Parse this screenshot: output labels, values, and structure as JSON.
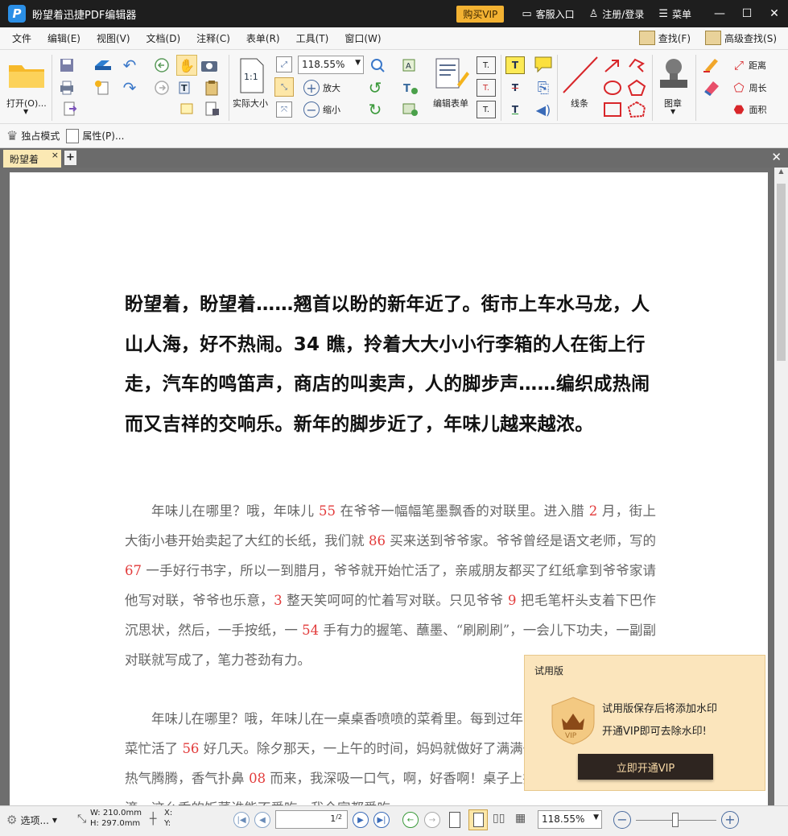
{
  "app": {
    "title": "盼望着迅捷PDF编辑器",
    "logo_letter": "P"
  },
  "titlebar": {
    "buy_vip": "购买VIP",
    "support": "客服入口",
    "login": "注册/登录",
    "menu": "菜单"
  },
  "menubar": {
    "items": [
      "文件",
      "编辑(E)",
      "视图(V)",
      "文档(D)",
      "注释(C)",
      "表单(R)",
      "工具(T)",
      "窗口(W)"
    ],
    "search": "查找(F)",
    "advanced_search": "高级查找(S)"
  },
  "toolbar": {
    "open": "打开(O)...",
    "actual_size": "实际大小",
    "zoom_value": "118.55%",
    "zoom_in": "放大",
    "zoom_out": "缩小",
    "edit_form": "编辑表单",
    "lines": "线条",
    "stamp": "图章",
    "distance": "距离",
    "perimeter": "周长",
    "area": "面积",
    "actual_size_icon": "1:1"
  },
  "modebar": {
    "exclusive": "独占模式",
    "properties": "属性(P)..."
  },
  "tabs": {
    "doc_tab": "盼望着"
  },
  "document": {
    "bold_paragraph": "盼望着，盼望着……翘首以盼的新年近了。街市上车水马龙，人山人海，好不热闹。34 瞧，拎着大大小小行李箱的人在街上行走，汽车的鸣笛声，商店的叫卖声，人的脚步声……编织成热闹而又吉祥的交响乐。新年的脚步近了，年味儿越来越浓。",
    "para1": [
      {
        "t": "年味儿在哪里？哦，年味儿 "
      },
      {
        "n": "55"
      },
      {
        "t": " 在爷爷一幅幅笔墨飘香的对联里。进入腊 "
      },
      {
        "n": "2"
      },
      {
        "t": " 月，街上大街小巷开始卖起了大红的长纸，我们就 "
      },
      {
        "n": "86"
      },
      {
        "t": " 买来送到爷爷家。爷爷曾经是语文老师，写的 "
      },
      {
        "n": "67"
      },
      {
        "t": " 一手好行书字，所以一到腊月，爷爷就开始忙活了，亲戚朋友都买了红纸拿到爷爷家请他写对联，爷爷也乐意，"
      },
      {
        "n": "3"
      },
      {
        "t": " 整天笑呵呵的忙着写对联。只见爷爷 "
      },
      {
        "n": "9"
      },
      {
        "t": " 把毛笔杆头支着下巴作沉思状，然后，一手按纸，一 "
      },
      {
        "n": "54"
      },
      {
        "t": " 手有力的握笔、蘸墨、“刷刷刷”，一会儿下功夫，一副副对联就写成了，笔力苍劲有力。"
      }
    ],
    "para2": [
      {
        "t": "年味儿在哪里？哦，年味儿在一桌桌香喷喷的菜肴里。每到过年，妈妈总要为过年的饭菜忙活了 "
      },
      {
        "n": "56"
      },
      {
        "t": " 好几天。除夕那天，一上午的时间，妈妈就做好了满满一桌子团年饭，饭桌上热气腾腾，香气扑鼻 "
      },
      {
        "n": "08"
      },
      {
        "t": " 而来，我深吸一口气，啊，好香啊！桌子上摆放的菜色让人垂涎欲滴，这么香的饭菜谁能不爱吃，我全家都爱吃。"
      }
    ]
  },
  "trial": {
    "title": "试用版",
    "msg1": "试用版保存后将添加水印",
    "msg2": "开通VIP即可去除水印!",
    "button": "立即开通VIP",
    "badge": "VIP"
  },
  "status": {
    "options": "选项...",
    "width": "W: 210.0mm",
    "height": "H: 297.0mm",
    "x": "X:",
    "y": "Y:",
    "page_current": "1",
    "page_total": "/2",
    "zoom": "118.55%"
  },
  "colors": {
    "accent_vip": "#f3b232",
    "number_red": "#e23b3b",
    "tab": "#fbe9b4"
  },
  "icons": [
    "folder-icon",
    "save-icon",
    "print-icon",
    "hand-icon",
    "camera-icon",
    "zoom-in-icon",
    "zoom-out-icon",
    "rotate-icon",
    "text-box-icon",
    "line-icon",
    "arrow-icon",
    "circle-icon",
    "rectangle-icon",
    "polygon-icon",
    "stamp-icon",
    "distance-icon",
    "perimeter-icon",
    "area-icon"
  ]
}
